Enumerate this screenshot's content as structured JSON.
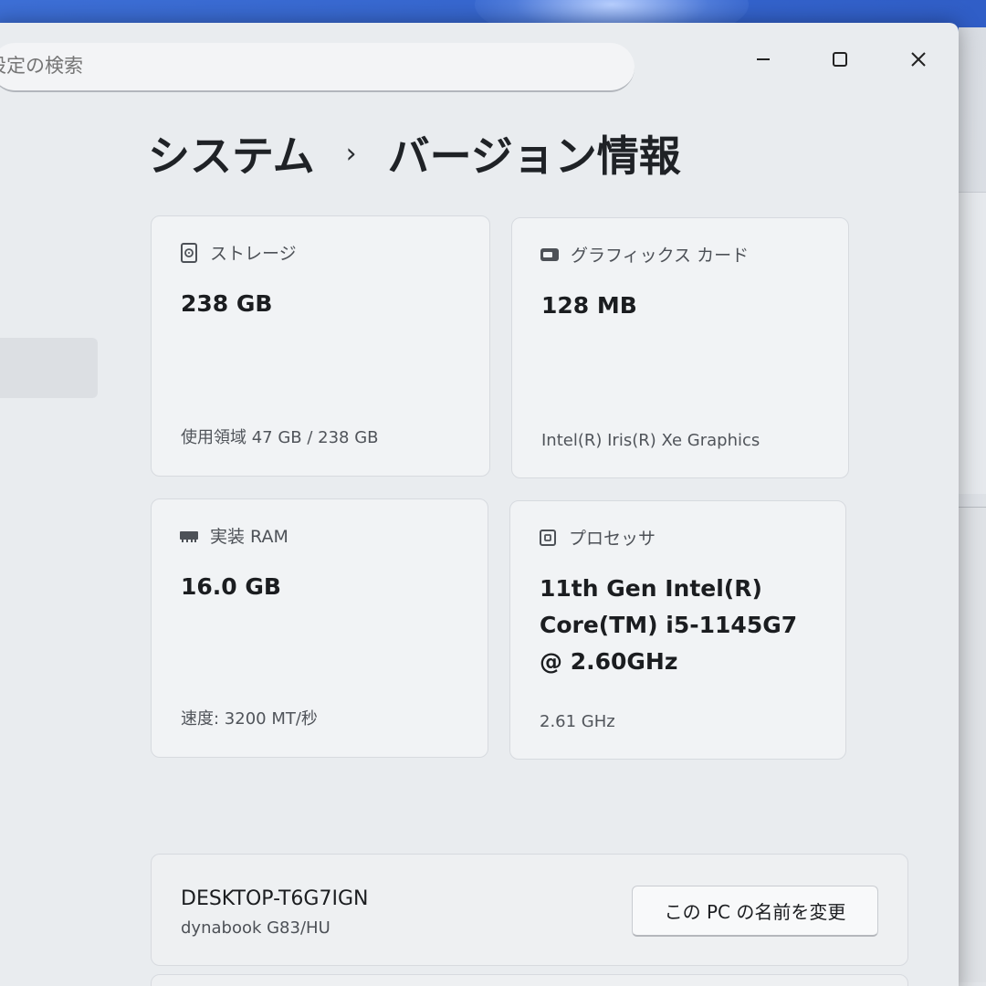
{
  "search": {
    "placeholder": "設定の検索"
  },
  "window_controls": {
    "minimize_icon": "minimize-icon",
    "maximize_icon": "maximize-icon",
    "close_icon": "close-icon"
  },
  "breadcrumb": {
    "parent": "システム",
    "separator": "›",
    "current": "バージョン情報"
  },
  "specs": {
    "storage": {
      "icon": "storage-drive-icon",
      "label": "ストレージ",
      "value": "238 GB",
      "detail": "使用領域 47 GB / 238 GB"
    },
    "graphics": {
      "icon": "graphics-card-icon",
      "label": "グラフィックス カード",
      "value": "128 MB",
      "detail": "Intel(R) Iris(R) Xe Graphics"
    },
    "ram": {
      "icon": "memory-icon",
      "label": "実装 RAM",
      "value": "16.0 GB",
      "detail": "速度: 3200 MT/秒"
    },
    "processor": {
      "icon": "processor-icon",
      "label": "プロセッサ",
      "value": "11th Gen Intel(R) Core(TM) i5-1145G7 @ 2.60GHz",
      "detail": "2.61 GHz"
    }
  },
  "device": {
    "name": "DESKTOP-T6G7IGN",
    "model": "dynabook G83/HU",
    "rename_button": "この PC の名前を変更"
  }
}
